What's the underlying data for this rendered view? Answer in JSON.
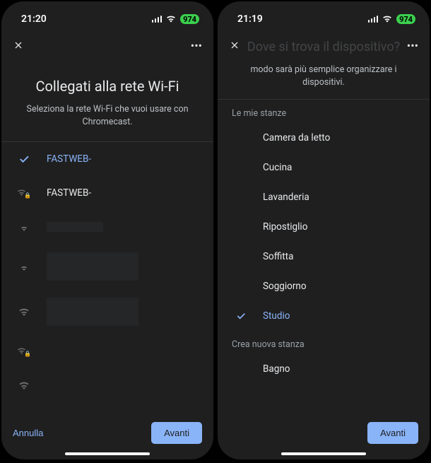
{
  "left": {
    "status_time": "21:20",
    "battery": "974",
    "title": "Collegati alla rete Wi-Fi",
    "subtitle": "Seleziona la rete Wi-Fi che vuoi usare con Chromecast.",
    "networks": [
      {
        "name": "FASTWEB-",
        "selected": true,
        "locked": false,
        "masked": true
      },
      {
        "name": "FASTWEB-",
        "selected": false,
        "locked": true,
        "masked": false
      },
      {
        "name": "",
        "selected": false,
        "locked": false,
        "masked": true
      },
      {
        "name": "",
        "selected": false,
        "locked": false,
        "masked": true
      },
      {
        "name": "",
        "selected": false,
        "locked": false,
        "masked": true
      },
      {
        "name": "",
        "selected": false,
        "locked": true,
        "masked": false
      },
      {
        "name": "",
        "selected": false,
        "locked": false,
        "masked": false
      }
    ],
    "cancel": "Annulla",
    "next": "Avanti"
  },
  "right": {
    "status_time": "21:19",
    "battery": "974",
    "faded_title": "Dove si trova il dispositivo?",
    "subtitle": "modo sarà più semplice organizzare i dispositivi.",
    "section_rooms": "Le mie stanze",
    "rooms": [
      {
        "name": "Camera da letto",
        "selected": false
      },
      {
        "name": "Cucina",
        "selected": false
      },
      {
        "name": "Lavanderia",
        "selected": false
      },
      {
        "name": "Ripostiglio",
        "selected": false
      },
      {
        "name": "Soffitta",
        "selected": false
      },
      {
        "name": "Soggiorno",
        "selected": false
      },
      {
        "name": "Studio",
        "selected": true
      }
    ],
    "section_create": "Crea nuova stanza",
    "create_rooms": [
      {
        "name": "Bagno"
      }
    ],
    "next": "Avanti"
  }
}
